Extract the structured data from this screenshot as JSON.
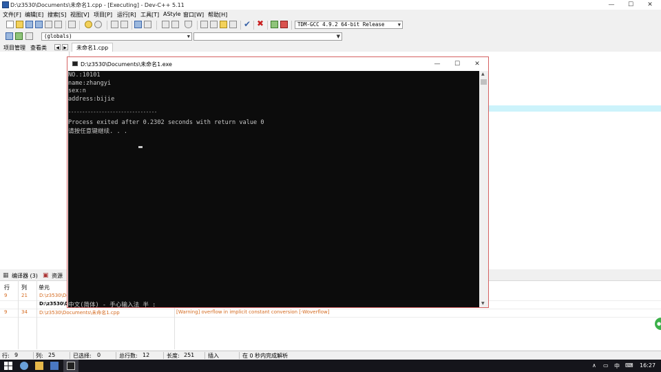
{
  "main_window": {
    "title": "D:\\z3530\\Documents\\未命名1.cpp - [Executing] - Dev-C++ 5.11",
    "minimize": "—",
    "maximize": "☐",
    "close": "✕"
  },
  "menu": [
    "文件[F]",
    "编辑[E]",
    "搜索[S]",
    "视图[V]",
    "项目[P]",
    "运行[R]",
    "工具[T]",
    "AStyle",
    "窗口[W]",
    "帮助[H]"
  ],
  "toolbar": {
    "compiler_select": "TDM-GCC 4.9.2 64-bit Release",
    "scope_select": "(globals)",
    "function_select": ""
  },
  "left_panel": {
    "tabs": [
      "项目管理",
      "查看类"
    ]
  },
  "editor": {
    "file_tab": "未命名1.cpp",
    "highlight_color": "#ccf3fb"
  },
  "console_window": {
    "title": "D:\\z3530\\Documents\\未命名1.exe",
    "lines": [
      "NO.:10101",
      "name:zhangyi",
      "sex:n",
      "address:bijie",
      "",
      "--------------------------------",
      "Process exited after 0.2302 seconds with return value 0",
      "请按任意键继续. . ."
    ],
    "ime_status": "中文(简体) - 手心输入法 半 :",
    "minimize": "—",
    "maximize": "☐",
    "close": "✕"
  },
  "bottom_panel": {
    "tabs": [
      "编译器 (3)",
      "资源"
    ],
    "columns": [
      "行",
      "列",
      "单元"
    ],
    "rows": [
      {
        "line": "9",
        "col": "21",
        "unit": "D:\\z3530\\Doc",
        "message": ""
      },
      {
        "line": "",
        "col": "",
        "unit": "D:\\z3530\\D",
        "message": ""
      },
      {
        "line": "9",
        "col": "34",
        "unit": "D:\\z3530\\Documents\\未命名1.cpp",
        "message": "[Warning] overflow in implicit constant conversion [-Woverflow]"
      }
    ]
  },
  "status_bar": {
    "line_label": "行:",
    "line_value": "9",
    "col_label": "列:",
    "col_value": "25",
    "selected_label": "已选择:",
    "selected_value": "0",
    "total_lines_label": "总行数:",
    "total_lines_value": "12",
    "length_label": "长度:",
    "length_value": "251",
    "mode": "插入",
    "parse_message": "在 0 秒内完成解析"
  },
  "taskbar": {
    "tray_up": "∧",
    "ime": "中",
    "clock": "16:27"
  },
  "colors": {
    "warning_text": "#d46a1f",
    "console_border": "#d46060",
    "console_background": "#0c0c0c"
  }
}
